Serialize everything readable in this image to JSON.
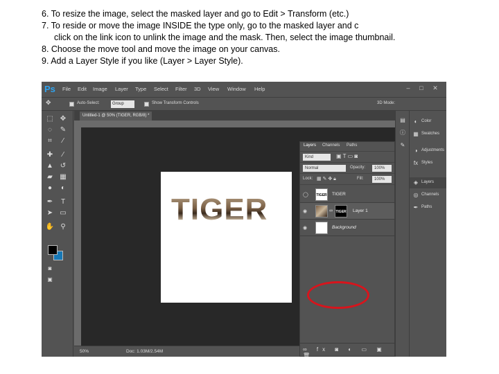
{
  "instructions": [
    "6. To resize the image, select the masked layer and go to Edit > Transform (etc.)",
    "7. To reside or move the image INSIDE the type only, go to the masked layer and c",
    "click on the link icon to unlink the image and the mask. Then, select the image thumbnail.",
    "8. Choose the move tool and move the image on your canvas.",
    "9. Add a Layer Style if you like (Layer > Layer Style)."
  ],
  "app": {
    "logo": "Ps",
    "menus": [
      "File",
      "Edit",
      "Image",
      "Layer",
      "Type",
      "Select",
      "Filter",
      "3D",
      "View",
      "Window",
      "Help"
    ],
    "window_controls": [
      "–",
      "□",
      "✕"
    ]
  },
  "options_bar": {
    "auto_select_label": "Auto-Select:",
    "auto_select_value": "Group",
    "show_transform_label": "Show Transform Controls",
    "mode_3d": "3D Mode:"
  },
  "document": {
    "tab_title": "Untitled-1 @ 50% (TIGER, RGB/8) *",
    "canvas_text": "TIGER"
  },
  "status_bar": {
    "zoom": "50%",
    "doc_info": "Doc: 1.03M/2.54M"
  },
  "layers_panel": {
    "tabs": [
      "Layers",
      "Channels",
      "Paths"
    ],
    "kind_label": "Kind",
    "blend_mode": "Normal",
    "opacity_label": "Opacity:",
    "opacity_value": "100%",
    "lock_label": "Lock:",
    "fill_label": "Fill:",
    "fill_value": "100%",
    "layers": [
      {
        "name": "TIGER",
        "thumb_text": "TIGER"
      },
      {
        "name": "Layer 1",
        "mask_text": "TIGER"
      },
      {
        "name": "Background"
      }
    ]
  },
  "side_panels": {
    "items": [
      "Color",
      "Swatches",
      "Adjustments",
      "Styles",
      "Layers",
      "Channels",
      "Paths"
    ]
  },
  "colors": {
    "highlight": "#d8141c",
    "ps_blue": "#2fa3ef",
    "background_swatch": "#1778b6",
    "foreground_swatch": "#000000"
  }
}
